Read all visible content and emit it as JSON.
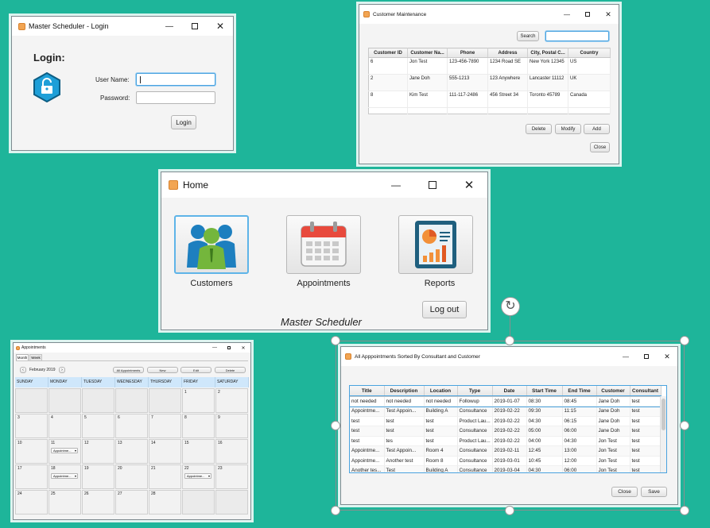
{
  "login": {
    "title": "Master Scheduler - Login",
    "heading": "Login:",
    "username_label": "User Name:",
    "password_label": "Password:",
    "username_value": "",
    "password_value": "",
    "login_button": "Login"
  },
  "customers": {
    "title": "Customer Maintenance",
    "search_button": "Search",
    "search_value": "",
    "columns": [
      "Customer ID",
      "Customer Na...",
      "Phone",
      "Address",
      "City, Postal C...",
      "Country"
    ],
    "rows": [
      [
        "6",
        "Jon Test",
        "123-456-7890",
        "1234 Road SE",
        "New York 12345",
        "US"
      ],
      [
        "2",
        "Jane Doh",
        "555-1213",
        "123 Anywhere",
        "Lancaster 11112",
        "UK"
      ],
      [
        "8",
        "Kim Test",
        "111-117-2486",
        "456 Street 34",
        "Toronto 45789",
        "Canada"
      ]
    ],
    "delete_button": "Delete",
    "modify_button": "Modify",
    "add_button": "Add",
    "close_button": "Close"
  },
  "home": {
    "title": "Home",
    "tiles": [
      {
        "label": "Customers",
        "icon": "people-icon"
      },
      {
        "label": "Appointments",
        "icon": "calendar-icon"
      },
      {
        "label": "Reports",
        "icon": "report-chart-icon"
      }
    ],
    "logout_button": "Log out",
    "footer": "Master Scheduler"
  },
  "calendar": {
    "title": "Appointments",
    "tabs": [
      "Month",
      "Week"
    ],
    "month_label": "February 2019",
    "buttons": [
      "All Appointments",
      "New",
      "Edit",
      "Delete"
    ],
    "days": [
      "SUNDAY",
      "MONDAY",
      "TUESDAY",
      "WEDNESDAY",
      "THURSDAY",
      "FRIDAY",
      "SATURDAY"
    ],
    "weeks": [
      [
        "",
        "",
        "",
        "",
        "",
        "1",
        "2"
      ],
      [
        "3",
        "4",
        "5",
        "6",
        "7",
        "8",
        "9"
      ],
      [
        "10",
        "11",
        "12",
        "13",
        "14",
        "15",
        "16"
      ],
      [
        "17",
        "18",
        "19",
        "20",
        "21",
        "22",
        "23"
      ],
      [
        "24",
        "25",
        "26",
        "27",
        "28",
        "",
        ""
      ]
    ],
    "appointment_label": "Appointme..."
  },
  "appointments": {
    "title": "All Apppointments Sorted By Consultant and Customer",
    "columns": [
      "Title",
      "Description",
      "Location",
      "Type",
      "Date",
      "Start Time",
      "End Time",
      "Customer",
      "Consultant"
    ],
    "rows": [
      [
        "not needed",
        "not needed",
        "not needed",
        "Followup",
        "2019-01-07",
        "08:30",
        "08:45",
        "Jane Doh",
        "test"
      ],
      [
        "Appointme...",
        "Test Appoin...",
        "Building A",
        "Consultance",
        "2019-02-22",
        "09:30",
        "11:15",
        "Jane Doh",
        "test"
      ],
      [
        "test",
        "test",
        "test",
        "Product Lau...",
        "2019-02-22",
        "04:30",
        "06:15",
        "Jane Doh",
        "test"
      ],
      [
        "test",
        "test",
        "test",
        "Consultance",
        "2019-02-22",
        "05:00",
        "06:00",
        "Jane Doh",
        "test"
      ],
      [
        "test",
        "tes",
        "test",
        "Product Lau...",
        "2019-02-22",
        "04:00",
        "04:30",
        "Jon Test",
        "test"
      ],
      [
        "Appointme...",
        "Test Appoin...",
        "Room 4",
        "Consultance",
        "2019-02-11",
        "12:45",
        "13:00",
        "Jon Test",
        "test"
      ],
      [
        "Appointme...",
        "Another test",
        "Room 8",
        "Consultance",
        "2019-03-01",
        "10:45",
        "12:00",
        "Jon Test",
        "test"
      ],
      [
        "Another tes...",
        "Test",
        "Building A",
        "Consultance",
        "2019-03-04",
        "04:30",
        "06:00",
        "Jon Test",
        "test"
      ]
    ],
    "close_button": "Close",
    "save_button": "Save"
  },
  "colors": {
    "background": "#1eb59a",
    "focus": "#4aa3df",
    "calendar_header": "#cfe7fb",
    "app_icon": "#f2a553"
  }
}
